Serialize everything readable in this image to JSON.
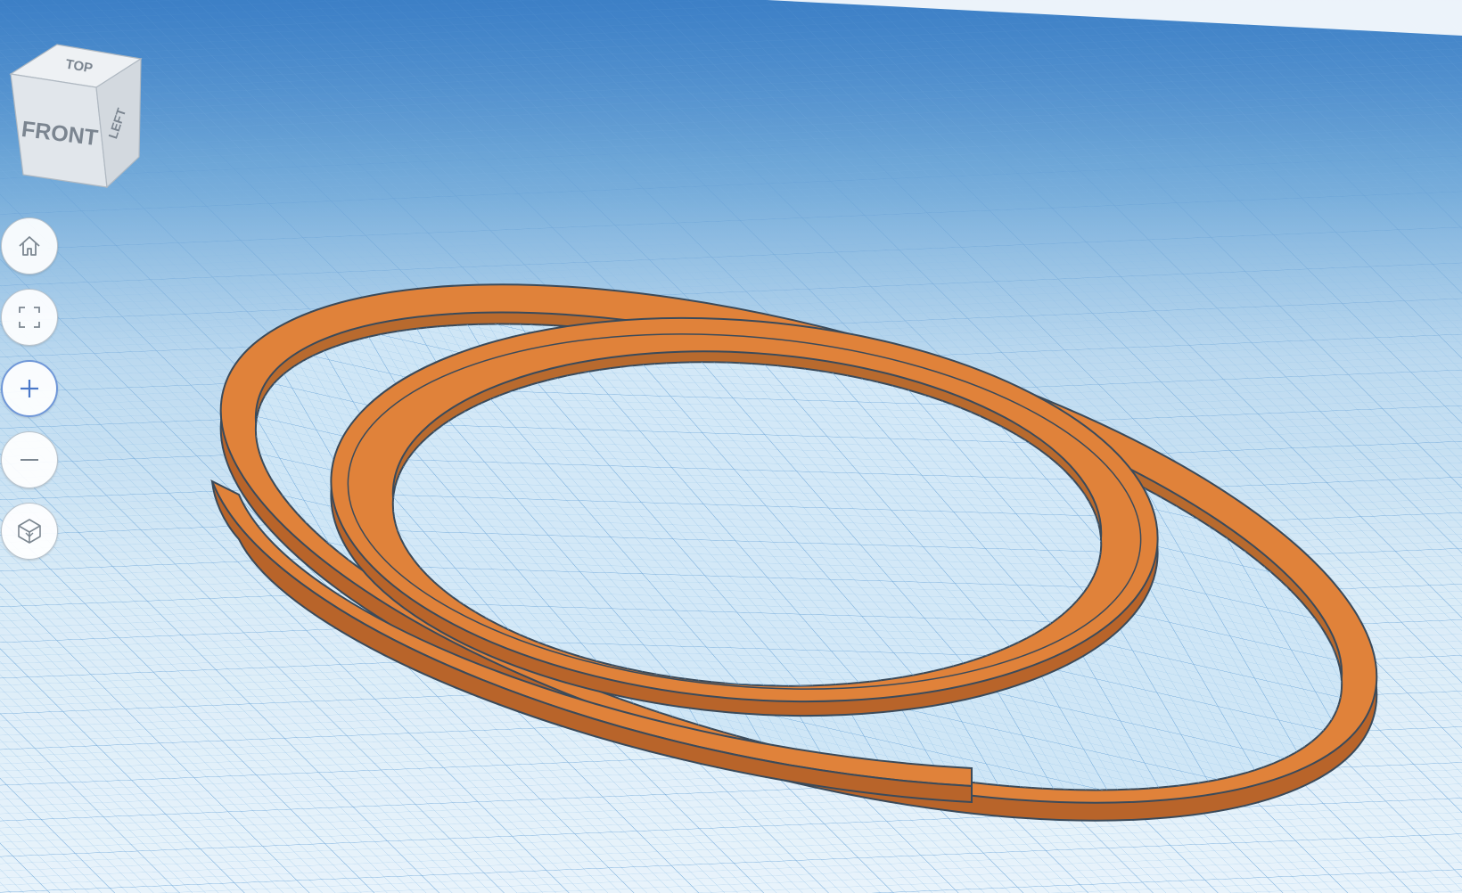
{
  "viewcube": {
    "top_label": "TOP",
    "front_label": "FRONT",
    "right_label": "LEFT"
  },
  "nav_controls": [
    {
      "name": "home-view-button",
      "icon": "home-icon"
    },
    {
      "name": "fit-view-button",
      "icon": "fit-to-view-icon"
    },
    {
      "name": "zoom-in-button",
      "icon": "plus-icon"
    },
    {
      "name": "zoom-out-button",
      "icon": "minus-icon"
    },
    {
      "name": "ortho-view-button",
      "icon": "perspective-cube-icon"
    }
  ],
  "colors": {
    "ring_face": "#e0823a",
    "ring_side": "#b8642a",
    "ring_outline": "#3a4a5a",
    "grid_line": "#8fbfe6",
    "button_icon": "#7c8791",
    "button_active_icon": "#4a78c9"
  }
}
